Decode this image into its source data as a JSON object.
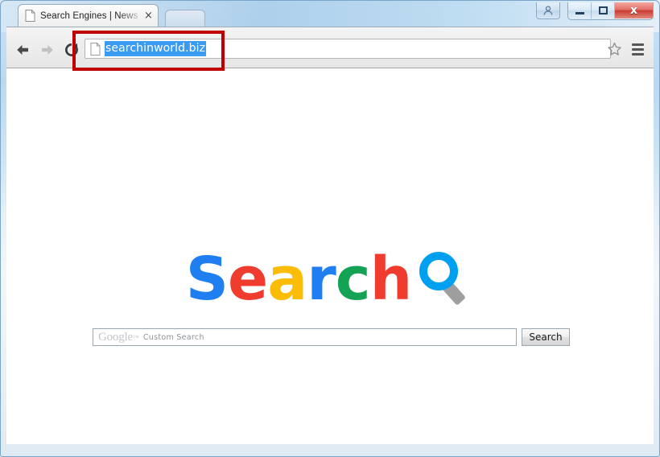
{
  "window": {
    "frame_color": "#bcd8ef",
    "controls": {
      "user_icon": "user-profile-icon",
      "minimize_label": "Minimize",
      "maximize_label": "Restore",
      "close_label": "x",
      "close_color": "#c83b30"
    }
  },
  "browser": {
    "tab": {
      "title": "Search Engines | News sea",
      "favicon": "page-icon",
      "close_label": "×"
    },
    "toolbar": {
      "back_label": "Back",
      "forward_label": "Forward",
      "reload_label": "Reload",
      "star_label": "Bookmark",
      "menu_label": "Menu"
    },
    "omnibox": {
      "url": "searchinworld.biz",
      "icon": "page-icon",
      "selected": true,
      "selection_color": "#3a9bf0"
    },
    "annotation": {
      "shape": "rectangle",
      "color": "#c00000",
      "target": "omnibox"
    }
  },
  "page": {
    "logo": {
      "letters": [
        {
          "char": "S",
          "color": "#1f7ef0"
        },
        {
          "char": "e",
          "color": "#f03c2e"
        },
        {
          "char": "a",
          "color": "#fbbc05"
        },
        {
          "char": "r",
          "color": "#1f7ef0"
        },
        {
          "char": "c",
          "color": "#14a254"
        },
        {
          "char": "h",
          "color": "#f03c2e"
        }
      ],
      "icon": "magnifier-icon",
      "icon_ring_color": "#00a0f0",
      "icon_handle_color": "#9e9e9e"
    },
    "search": {
      "placeholder_brand": "Google",
      "placeholder_tm": "™",
      "placeholder_rest": "Custom Search",
      "value": "",
      "button_label": "Search"
    }
  }
}
